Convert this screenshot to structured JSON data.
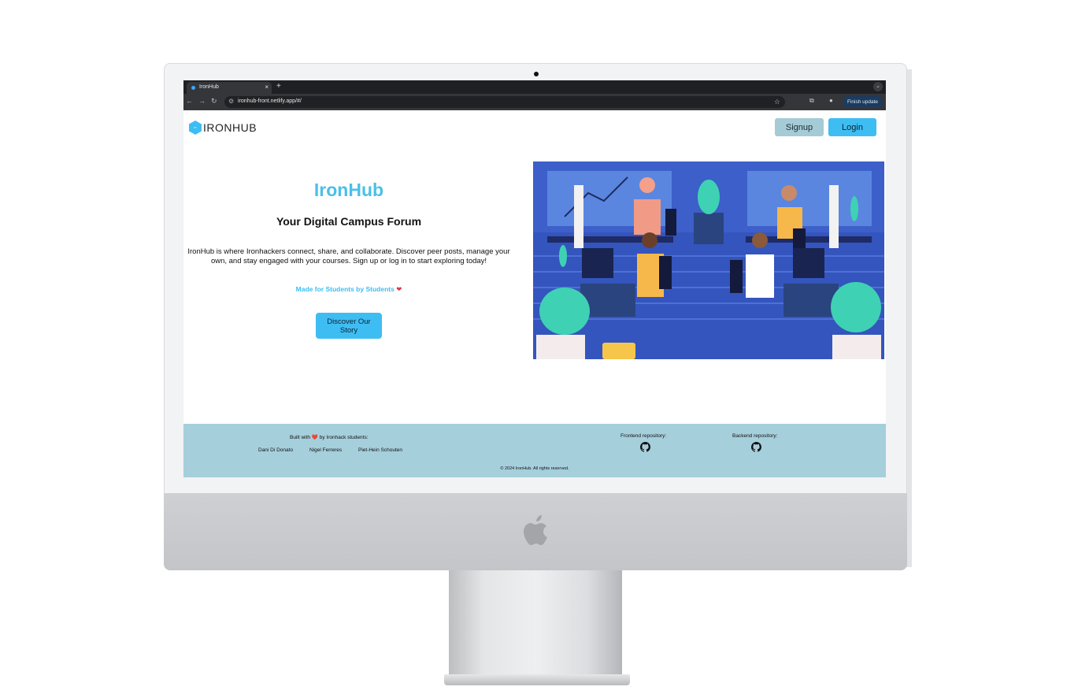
{
  "browser": {
    "tab_title": "IronHub",
    "tab_close": "×",
    "new_tab": "+",
    "url": "ironhub-front.netlify.app/#/",
    "update_button": "Finish update"
  },
  "header": {
    "brand": "IRONHUB",
    "signup_label": "Signup",
    "login_label": "Login"
  },
  "hero": {
    "title": "IronHub",
    "subtitle": "Your Digital Campus Forum",
    "description": "IronHub is where Ironhackers connect, share, and collaborate. Discover peer posts, manage your own, and stay engaged with your courses. Sign up or log in to start exploring today!",
    "tagline": "Made for Students by Students",
    "cta_label": "Discover Our Story"
  },
  "footer": {
    "built_by": "Built with ❤️ by Ironhack students:",
    "authors": [
      "Dani Di Donato",
      "Nigel Ferreres",
      "Piet-Hein Schouten"
    ],
    "frontend_label": "Frontend repository:",
    "backend_label": "Backend repository:",
    "copyright": "© 2024 IronHub. All rights reserved."
  },
  "colors": {
    "accent": "#3ebdf2",
    "signup_bg": "#a5cbd6",
    "footer_bg": "#a6cfdc",
    "illustration_blue": "#4466cc"
  },
  "icons": {
    "heart": "heart-icon",
    "github": "github-icon"
  }
}
